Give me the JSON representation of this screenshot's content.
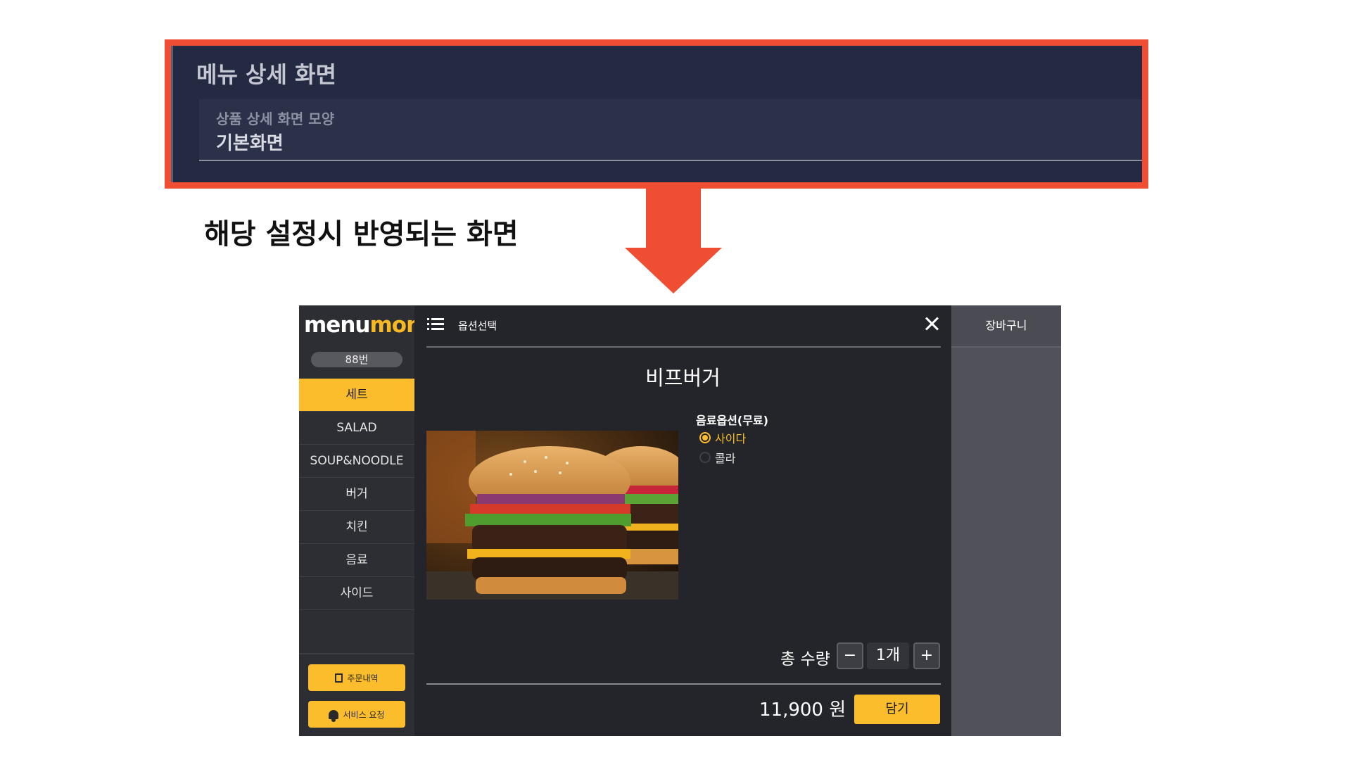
{
  "settings": {
    "title": "메뉴 상세 화면",
    "field_label": "상품 상세 화면 모양",
    "field_value": "기본화면"
  },
  "caption": "해당 설정시 반영되는 화면",
  "colors": {
    "highlight": "#f04e32",
    "accent": "#fbbd2b",
    "panel_bg": "#242a42"
  },
  "app": {
    "logo_part1": "menu",
    "logo_part2": "mon",
    "table_number": "88번",
    "categories": [
      {
        "label": "세트",
        "active": true
      },
      {
        "label": "SALAD",
        "active": false
      },
      {
        "label": "SOUP&NOODLE",
        "active": false
      },
      {
        "label": "버거",
        "active": false
      },
      {
        "label": "치킨",
        "active": false
      },
      {
        "label": "음료",
        "active": false
      },
      {
        "label": "사이드",
        "active": false
      }
    ],
    "order_history_label": "주문내역",
    "order_history_icon": "receipt-icon",
    "service_request_label": "서비스 요청",
    "service_request_icon": "bell-icon",
    "option_title": "옵션선택",
    "menu_name": "비프버거",
    "option_group": {
      "title": "음료옵션(무료)",
      "options": [
        {
          "label": "사이다",
          "selected": true
        },
        {
          "label": "콜라",
          "selected": false
        }
      ]
    },
    "quantity_label": "총 수량",
    "minus_label": "−",
    "plus_label": "+",
    "quantity_value": "1개",
    "price": "11,900 원",
    "add_button": "담기",
    "cart_title": "장바구니"
  }
}
